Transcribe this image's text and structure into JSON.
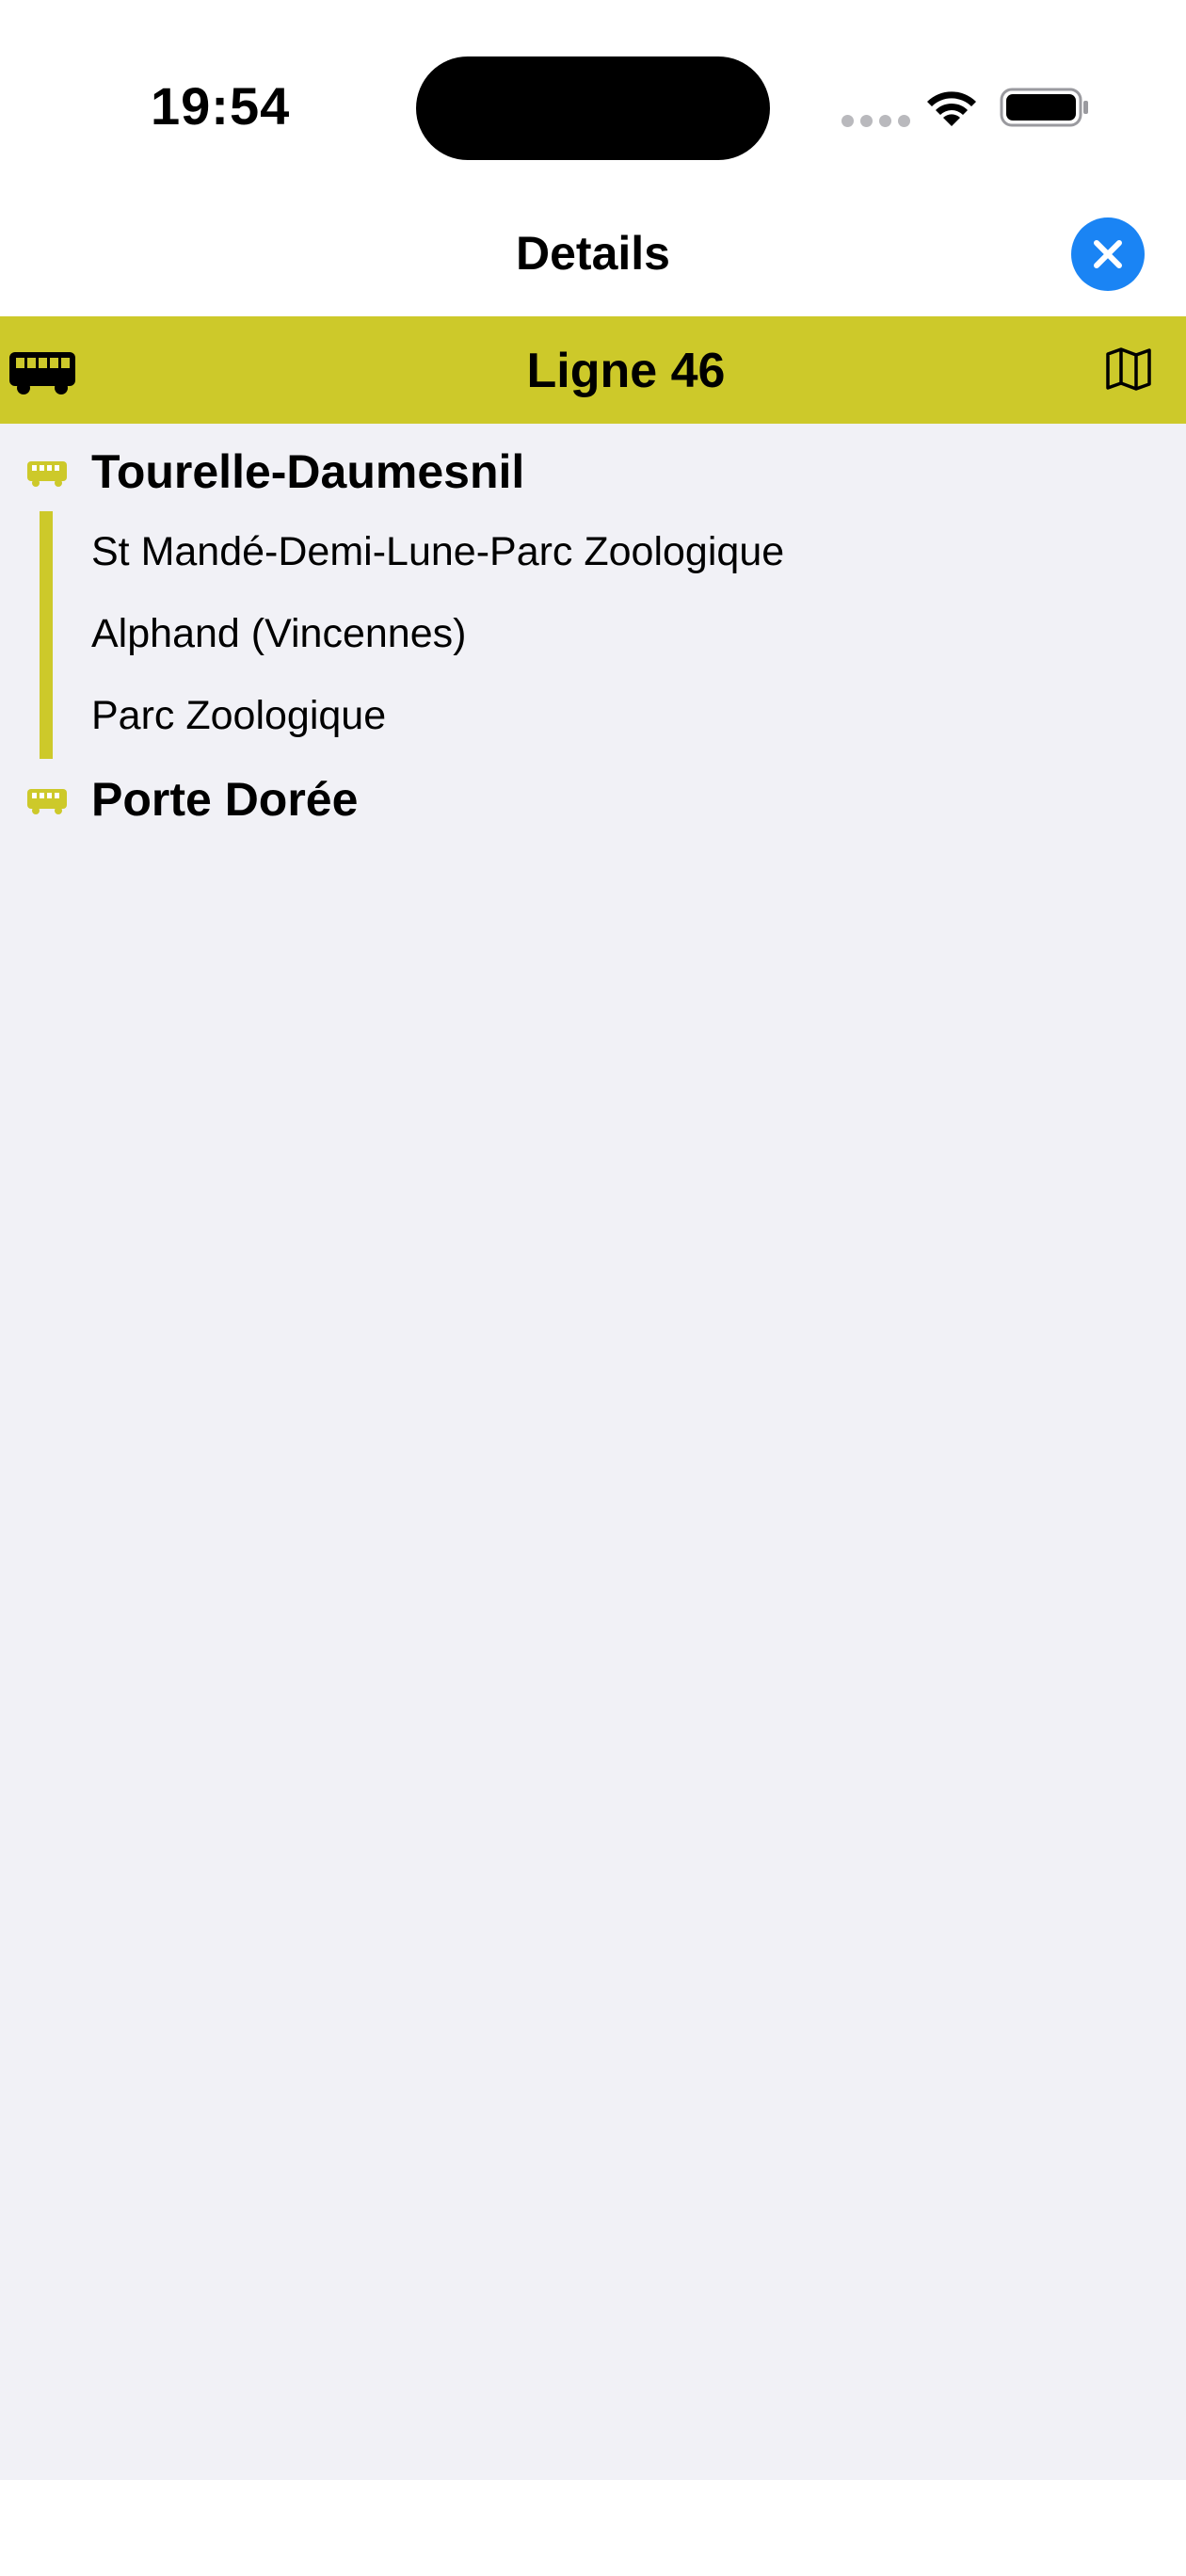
{
  "status_bar": {
    "time": "19:54"
  },
  "nav": {
    "title": "Details",
    "close_icon": "xmark-circle-icon"
  },
  "line": {
    "title": "Ligne 46",
    "color": "#cdc92a",
    "mode_icon": "bus-icon",
    "map_icon": "map-icon"
  },
  "route": {
    "origin": "Tourelle-Daumesnil",
    "intermediate_stops": [
      "St Mandé-Demi-Lune-Parc Zoologique",
      "Alphand (Vincennes)",
      "Parc Zoologique"
    ],
    "destination": "Porte Dorée"
  },
  "colors": {
    "accent": "#1a84f4",
    "background": "#f1f1f6"
  }
}
